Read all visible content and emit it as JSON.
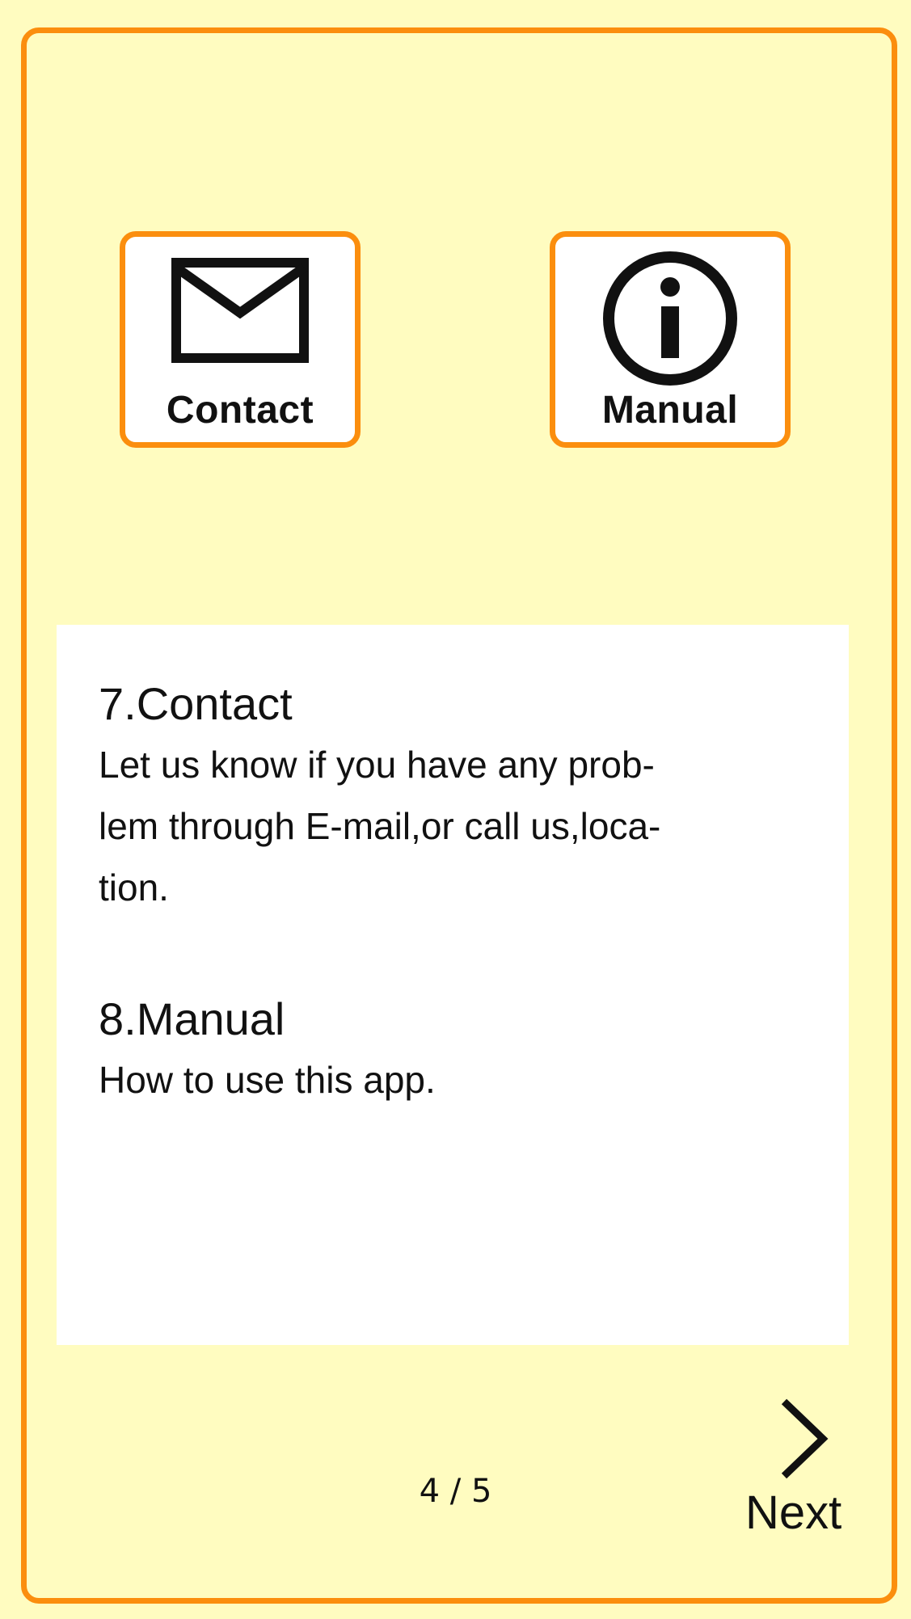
{
  "buttons": {
    "contact": {
      "label": "Contact",
      "icon": "envelope-icon"
    },
    "manual": {
      "label": "Manual",
      "icon": "info-icon"
    }
  },
  "sections": [
    {
      "title": "7.Contact",
      "body": "Let us know if you have any prob-\nlem through E-mail,or call us,loca-\ntion."
    },
    {
      "title": "8.Manual",
      "body": "How to use this app."
    }
  ],
  "pager": {
    "current": "4",
    "separator": "/",
    "total": "5",
    "text": "4 / 5"
  },
  "navigation": {
    "next_label": "Next",
    "next_icon": "chevron-right-icon"
  },
  "colors": {
    "background": "#fffcc0",
    "accent": "#fb8e0e",
    "panel": "#ffffff",
    "text": "#111111"
  }
}
